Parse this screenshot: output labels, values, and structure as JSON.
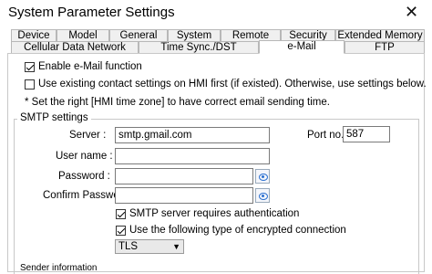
{
  "window": {
    "title": "System Parameter Settings",
    "close_glyph": "✕"
  },
  "tabs_row1": [
    {
      "label": "Device"
    },
    {
      "label": "Model"
    },
    {
      "label": "General"
    },
    {
      "label": "System"
    },
    {
      "label": "Remote"
    },
    {
      "label": "Security"
    },
    {
      "label": "Extended Memory"
    }
  ],
  "tabs_row2": [
    {
      "label": "Cellular Data Network"
    },
    {
      "label": "Time Sync./DST"
    },
    {
      "label": "e-Mail",
      "active": true
    },
    {
      "label": "FTP"
    }
  ],
  "email": {
    "enable_label": "Enable e-Mail function",
    "enable_checked": true,
    "use_existing_label": "Use existing contact settings on HMI first (if existed). Otherwise, use settings below.",
    "use_existing_checked": false,
    "note": "* Set the right [HMI time zone] to have correct email sending time."
  },
  "smtp": {
    "group_title": "SMTP settings",
    "server_label": "Server :",
    "server_value": "smtp.gmail.com",
    "port_label": "Port no. :",
    "port_value": "587",
    "username_label": "User name :",
    "username_value": "",
    "password_label": "Password :",
    "password_value": "",
    "confirm_label": "Confirm Password :",
    "confirm_value": "",
    "auth_label": "SMTP server requires authentication",
    "auth_checked": true,
    "encrypt_label": "Use the following type of encrypted connection",
    "encrypt_checked": true,
    "encryption_type": "TLS"
  },
  "sender": {
    "group_title": "Sender information"
  },
  "icons": {
    "eye": "eye-icon",
    "dropdown": "chevron-down-icon",
    "close": "close-icon"
  }
}
